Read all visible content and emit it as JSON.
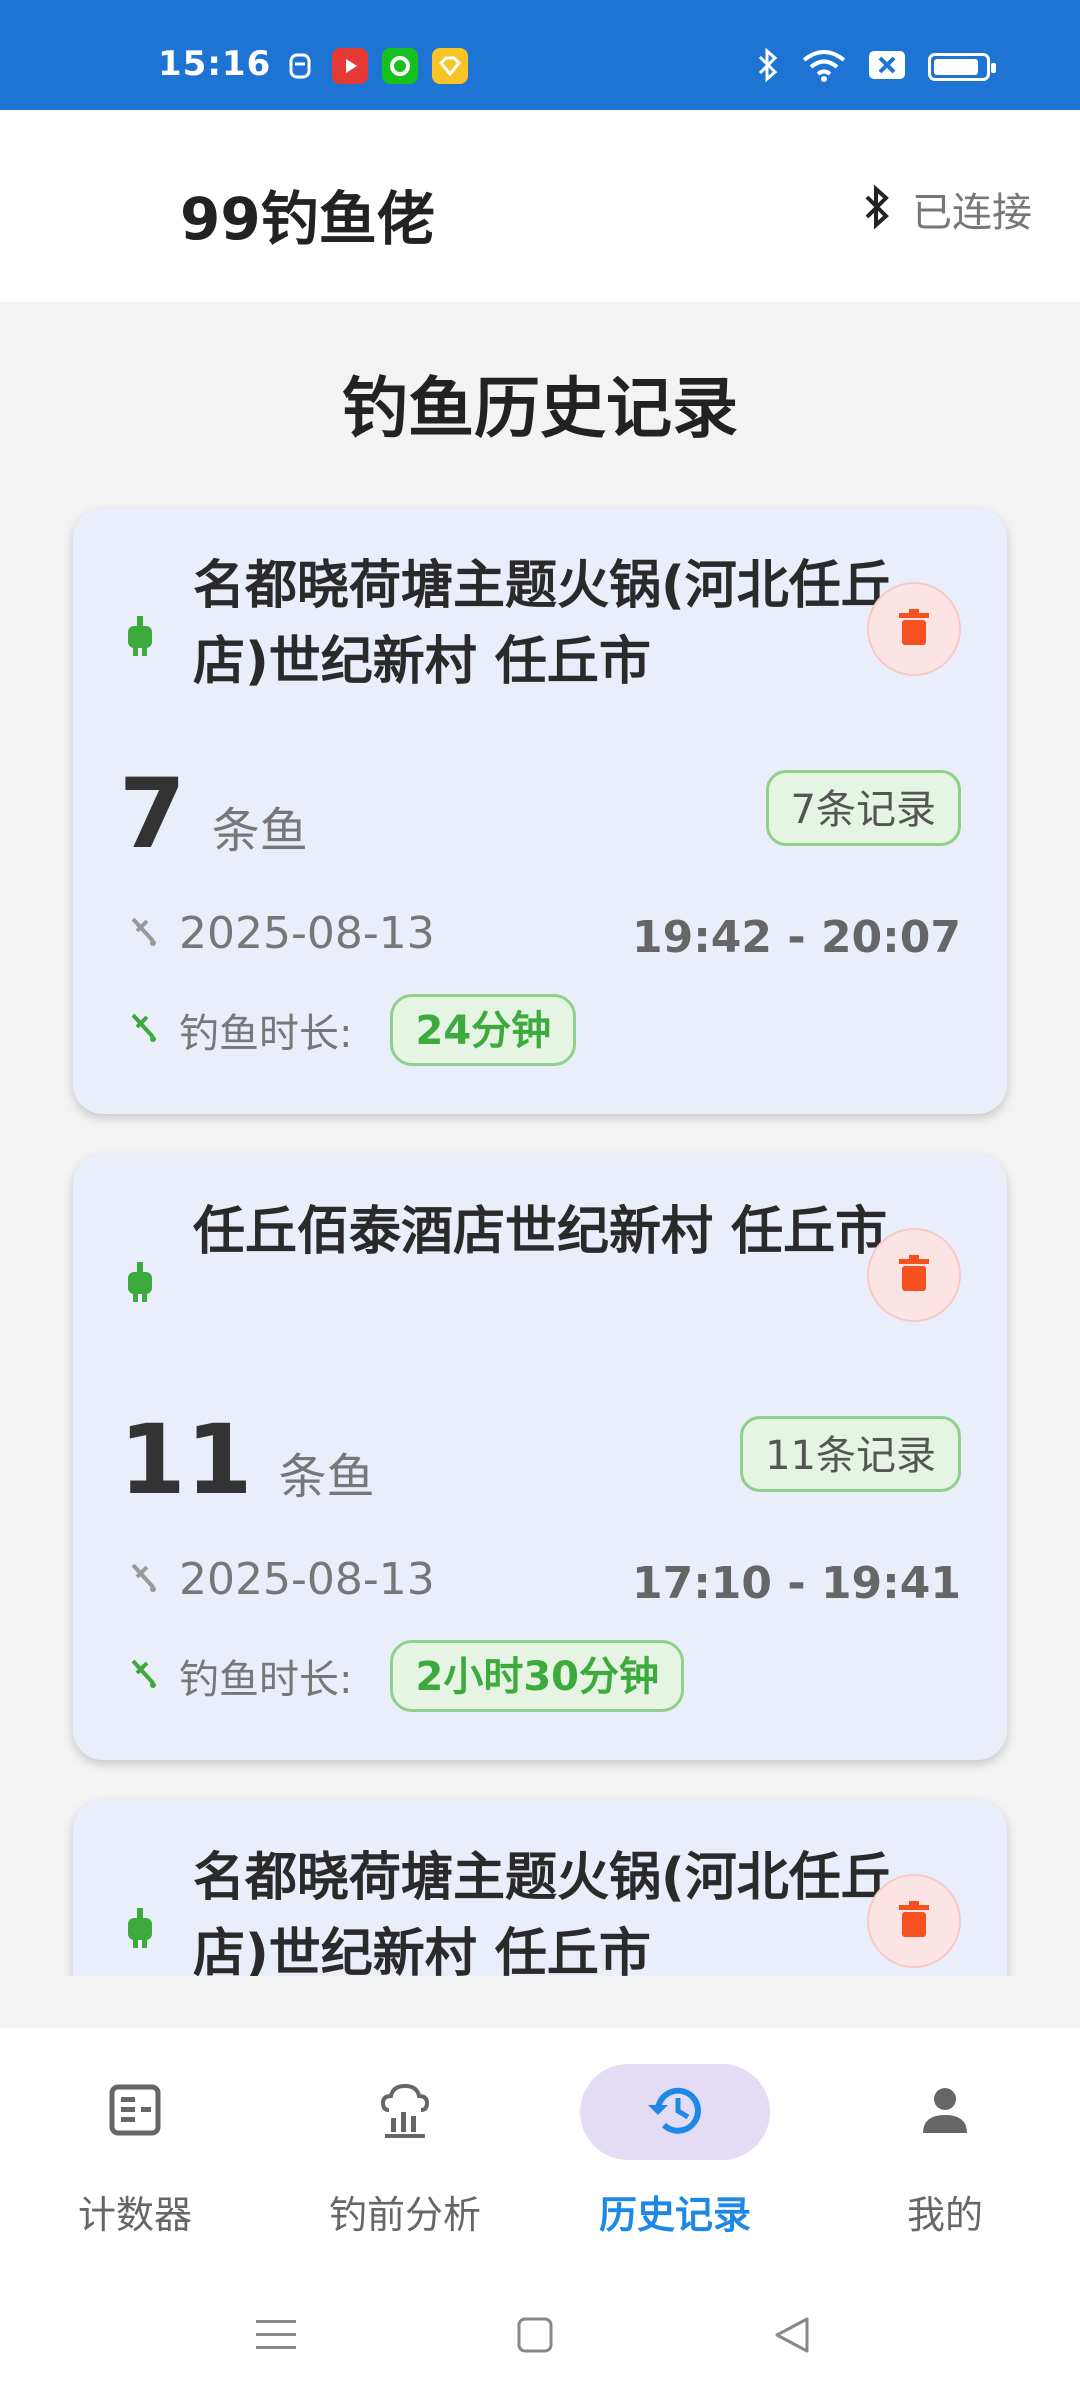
{
  "status_bar": {
    "time": "15:16",
    "battery_level": 0.9,
    "icons": [
      "notification-icon",
      "video-app-icon",
      "green-app-icon",
      "yellow-app-icon",
      "bluetooth-icon",
      "wifi-icon",
      "sim-icon",
      "battery-icon"
    ]
  },
  "app_bar": {
    "title": "99钓鱼佬",
    "bluetooth_status": "已连接"
  },
  "page": {
    "title": "钓鱼历史记录"
  },
  "records": [
    {
      "location": "名都晓荷塘主题火锅(河北任丘店)世纪新村 任丘市",
      "count": "7",
      "unit": "条鱼",
      "records_badge": "7条记录",
      "date": "2025-08-13",
      "time_range": "19:42 - 20:07",
      "duration_label": "钓鱼时长:",
      "duration": "24分钟"
    },
    {
      "location": "任丘佰泰酒店世纪新村 任丘市",
      "count": "11",
      "unit": "条鱼",
      "records_badge": "11条记录",
      "date": "2025-08-13",
      "time_range": "17:10 - 19:41",
      "duration_label": "钓鱼时长:",
      "duration": "2小时30分钟"
    },
    {
      "location": "名都晓荷塘主题火锅(河北任丘店)世纪新村 任丘市"
    }
  ],
  "bottom_nav": {
    "items": [
      {
        "label": "计数器",
        "icon": "counter-icon"
      },
      {
        "label": "钓前分析",
        "icon": "weather-analysis-icon"
      },
      {
        "label": "历史记录",
        "icon": "history-icon"
      },
      {
        "label": "我的",
        "icon": "person-icon"
      }
    ],
    "active_index": 2
  },
  "colors": {
    "status_bar": "#1e74d2",
    "card_bg": "#eaeefb",
    "accent_green": "#3caa3c",
    "delete_red": "#f4511e",
    "active_blue": "#1e88e5",
    "active_pill": "#e3dcf4"
  }
}
